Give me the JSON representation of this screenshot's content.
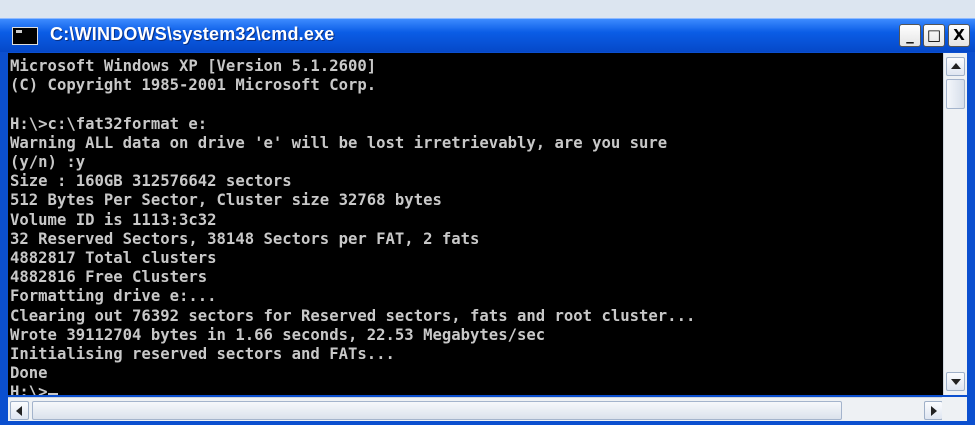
{
  "window": {
    "title": "C:\\WINDOWS\\system32\\cmd.exe",
    "controls": {
      "minimize": "_",
      "maximize": "□",
      "close": "X"
    }
  },
  "console": {
    "lines": [
      "Microsoft Windows XP [Version 5.1.2600]",
      "(C) Copyright 1985-2001 Microsoft Corp.",
      "",
      "H:\\>c:\\fat32format e:",
      "Warning ALL data on drive 'e' will be lost irretrievably, are you sure",
      "(y/n) :y",
      "Size : 160GB 312576642 sectors",
      "512 Bytes Per Sector, Cluster size 32768 bytes",
      "Volume ID is 1113:3c32",
      "32 Reserved Sectors, 38148 Sectors per FAT, 2 fats",
      "4882817 Total clusters",
      "4882816 Free Clusters",
      "Formatting drive e:...",
      "Clearing out 76392 sectors for Reserved sectors, fats and root cluster...",
      "Wrote 39112704 bytes in 1.66 seconds, 22.53 Megabytes/sec",
      "Initialising reserved sectors and FATs...",
      "Done",
      "H:\\>"
    ]
  },
  "colors": {
    "title_bar": "#0b5de6",
    "console_bg": "#000000",
    "console_text": "#c8c8c8"
  }
}
